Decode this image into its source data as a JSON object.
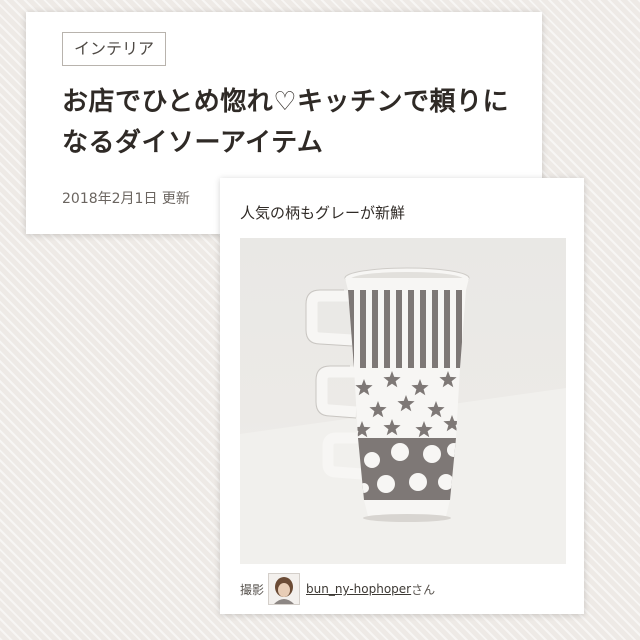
{
  "article": {
    "category": "インテリア",
    "title": "お店でひとめ惚れ♡キッチンで頼りになるダイソーアイテム",
    "updated": "2018年2月1日 更新"
  },
  "photo": {
    "caption": "人気の柄もグレーが新鮮",
    "credit_label": "撮影",
    "username": "bun_ny-hophoper",
    "honorific": "さん",
    "image_icon": "stacked-mugs-photo",
    "avatar_icon": "user-avatar"
  },
  "colors": {
    "mug_gray": "#7e7876",
    "mug_white": "#f7f6f4",
    "text_dark": "#2f2a26",
    "tag_border": "#b8b3ad"
  }
}
